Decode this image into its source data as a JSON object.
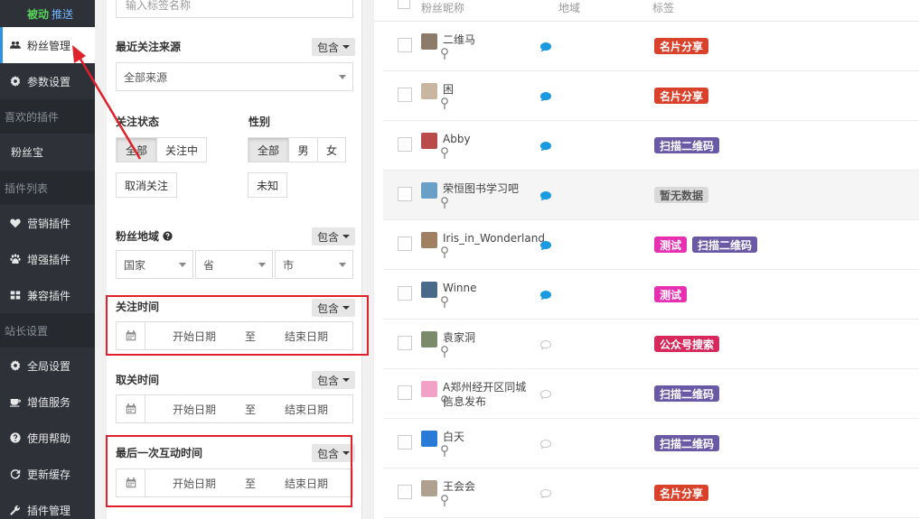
{
  "sidebar": {
    "top": {
      "t1": "被动",
      "t2": "推送"
    },
    "items": [
      {
        "label": "粉丝管理",
        "active": true,
        "icon": "users-icon"
      },
      {
        "label": "参数设置",
        "icon": "gear-icon"
      }
    ],
    "sec_fav": "喜欢的插件",
    "fav_item": "粉丝宝",
    "sec_plugins": "插件列表",
    "plugin_items": [
      {
        "label": "营销插件",
        "icon": "heart-icon"
      },
      {
        "label": "增强插件",
        "icon": "paw-icon"
      },
      {
        "label": "兼容插件",
        "icon": "grid-icon"
      }
    ],
    "sec_admin": "站长设置",
    "admin_items": [
      {
        "label": "全局设置",
        "icon": "gear-icon"
      },
      {
        "label": "增值服务",
        "icon": "cup-icon"
      },
      {
        "label": "使用帮助",
        "icon": "help-icon"
      },
      {
        "label": "更新缓存",
        "icon": "refresh-icon"
      },
      {
        "label": "插件管理",
        "icon": "wrench-icon"
      }
    ]
  },
  "filter": {
    "tag_placeholder": "输入标签名称",
    "source_label": "最近关注来源",
    "include": "包含",
    "source_value": "全部来源",
    "status_label": "关注状态",
    "status_btns": [
      "全部",
      "关注中",
      "取消关注"
    ],
    "gender_label": "性别",
    "gender_btns": [
      "全部",
      "男",
      "女",
      "未知"
    ],
    "region_label": "粉丝地域",
    "region_selects": [
      "国家",
      "省",
      "市"
    ],
    "follow_time_label": "关注时间",
    "unfollow_time_label": "取关时间",
    "last_interact_label": "最后一次互动时间",
    "date_start": "开始日期",
    "date_to": "至",
    "date_end": "结束日期"
  },
  "list": {
    "headers": {
      "nick": "粉丝昵称",
      "region": "地域",
      "tags": "标签"
    },
    "rows": [
      {
        "nick": "二维马",
        "chat": "blue",
        "tags": [
          {
            "text": "名片分享",
            "color": "t-red"
          }
        ]
      },
      {
        "nick": "困",
        "chat": "blue",
        "tags": [
          {
            "text": "名片分享",
            "color": "t-red"
          }
        ]
      },
      {
        "nick": "Abby",
        "chat": "blue",
        "tags": [
          {
            "text": "扫描二维码",
            "color": "t-purple"
          }
        ]
      },
      {
        "nick": "荣恒图书学习吧",
        "chat": "blue",
        "hl": true,
        "tags": [
          {
            "text": "暂无数据",
            "color": "t-gray"
          }
        ]
      },
      {
        "nick": "Iris_in_Wonderland",
        "chat": "blue",
        "tags": [
          {
            "text": "测试",
            "color": "t-pink"
          },
          {
            "text": "扫描二维码",
            "color": "t-purple"
          }
        ]
      },
      {
        "nick": "Winne",
        "chat": "blue",
        "tags": [
          {
            "text": "测试",
            "color": "t-pink"
          }
        ]
      },
      {
        "nick": "袁家洞",
        "chat": "gray",
        "tags": [
          {
            "text": "公众号搜索",
            "color": "t-crimson"
          }
        ]
      },
      {
        "nick": "A郑州经开区同城信息发布",
        "chat": "gray",
        "tags": [
          {
            "text": "扫描二维码",
            "color": "t-purple"
          }
        ]
      },
      {
        "nick": "白天",
        "chat": "gray",
        "tags": [
          {
            "text": "扫描二维码",
            "color": "t-purple"
          }
        ]
      },
      {
        "nick": "王会会",
        "chat": "gray",
        "tags": [
          {
            "text": "名片分享",
            "color": "t-red"
          }
        ]
      }
    ]
  },
  "colors": {
    "accent": "#2c93e0",
    "sidebar_bg": "#2e3238",
    "annotation": "#e0202a"
  }
}
